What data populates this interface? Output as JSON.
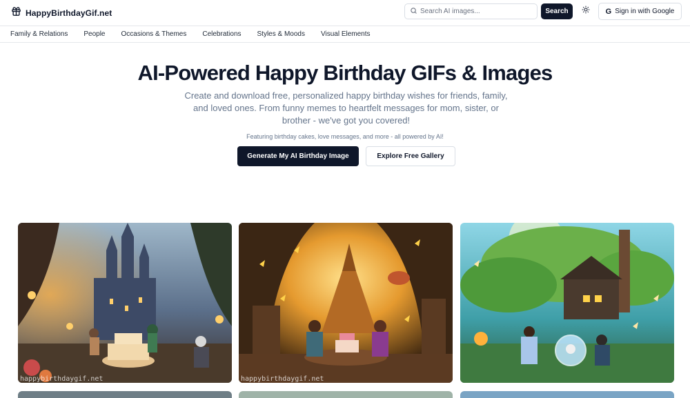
{
  "header": {
    "site_name": "HappyBirthdayGif.net",
    "search_placeholder": "Search AI images...",
    "search_button": "Search",
    "signin_label": "Sign in with Google",
    "google_glyph": "G",
    "icons": {
      "logo": "gift-icon",
      "search": "search-icon",
      "theme": "sun-icon",
      "google": "google-icon"
    }
  },
  "nav": {
    "items": [
      "Family & Relations",
      "People",
      "Occasions & Themes",
      "Celebrations",
      "Styles & Moods",
      "Visual Elements"
    ]
  },
  "hero": {
    "title": "AI-Powered Happy Birthday GIFs & Images",
    "description": "Create and download free, personalized happy birthday wishes for friends, family, and loved ones. From funny memes to heartfelt messages for mom, sister, or brother - we've got you covered!",
    "note": "Featuring birthday cakes, love messages, and more - all powered by AI!",
    "primary_button": "Generate My AI Birthday Image",
    "secondary_button": "Explore Free Gallery"
  },
  "gallery": {
    "watermark": "happybirthdaygif.net",
    "images": [
      {
        "scene": "castle-garden-birthday-cake"
      },
      {
        "scene": "enchanted-tree-cave-tea-party"
      },
      {
        "scene": "treehouse-crystal-ball-party"
      }
    ]
  },
  "colors": {
    "primary": "#0f172a",
    "muted": "#64748b",
    "border": "#d9dee5"
  }
}
